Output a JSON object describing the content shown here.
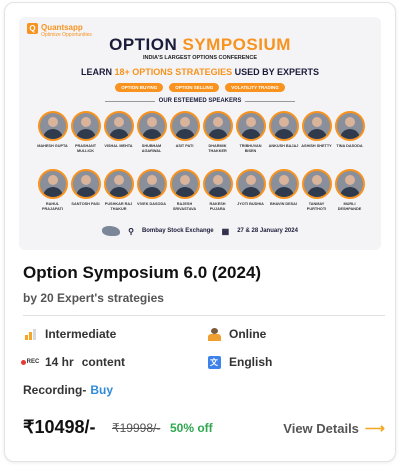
{
  "banner": {
    "brand_name": "Quantsapp",
    "brand_tag": "Optimize Opportunities",
    "title_part1": "OPTION",
    "title_part2": "SYMPOSIUM",
    "subtitle": "INDIA'S LARGEST OPTIONS CONFERENCE",
    "learn_prefix": "LEARN",
    "learn_highlight": "18+ OPTIONS STRATEGIES",
    "learn_suffix": "USED BY EXPERTS",
    "pills": [
      "OPTION BUYING",
      "OPTION SELLING",
      "VOLATILITY TRADING"
    ],
    "speakers_heading": "OUR ESTEEMED SPEAKERS",
    "speakers_row1": [
      "MAHESH GUPTA",
      "PRASHANT MULLICK",
      "VISHAL MEHTA",
      "SHUBHAM AGARWAL",
      "ASIT PATI",
      "DHARMIK THAKKER",
      "TRIBHUVAN BISEN",
      "ANKUSH BAJAJ",
      "ASHISH SHETTY",
      "TINA DASODA"
    ],
    "speakers_row2": [
      "RAHUL PRAJAPATI",
      "SANTOSH PASI",
      "PUSHKAR RAJ THAKUR",
      "VIVEK DASODA",
      "RAJESH SRIVASTAVA",
      "RAKESH PUJARA",
      "JYOTI BUDHIA",
      "BHAVIN DESAI",
      "TANMAY PURTHOTI",
      "MURLI DESHPANDE"
    ],
    "venue": "Bombay Stock Exchange",
    "dates": "27 & 28 January 2024"
  },
  "course": {
    "title": "Option Symposium 6.0 (2024)",
    "subtitle": "by 20 Expert's strategies",
    "level": "Intermediate",
    "level_bars_filled": 2,
    "mode": "Online",
    "hours": "14 hr",
    "hours_suffix": "content",
    "rec_badge": "REC",
    "language": "English",
    "language_icon_glyph": "文",
    "recording_label": "Recording-",
    "recording_action": "Buy",
    "price": "₹10498/-",
    "original_price": "₹19998/-",
    "discount": "50% off",
    "view_details": "View Details"
  },
  "icons": {
    "level": "signal-bars-icon",
    "mode": "person-online-icon",
    "hours": "record-icon",
    "language": "translate-icon",
    "arrow": "arrow-right-icon"
  },
  "colors": {
    "accent": "#f7931e",
    "discount": "#2fa84f",
    "link": "#2f8bd8"
  }
}
